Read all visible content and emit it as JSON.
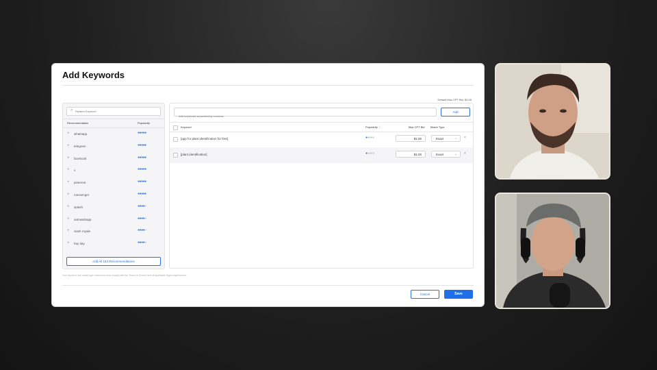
{
  "modal": {
    "title": "Add Keywords",
    "default_bid": "Default Max CPT Bid: $1.00",
    "footnote": "Your keyword and match type selections must comply with the Terms of Service and all applicable legal requirements.",
    "cancel_label": "Cancel",
    "save_label": "Save"
  },
  "recommendations": {
    "search_placeholder": "Related Keyword",
    "col_recommendation": "Recommendation",
    "col_popularity": "Popularity",
    "items": [
      {
        "label": "whatsapp",
        "popularity": 5
      },
      {
        "label": "telegram",
        "popularity": 5
      },
      {
        "label": "facebook",
        "popularity": 5
      },
      {
        "label": "x",
        "popularity": 5
      },
      {
        "label": "pinterest",
        "popularity": 5
      },
      {
        "label": "messenger",
        "popularity": 5
      },
      {
        "label": "splash",
        "popularity": 4
      },
      {
        "label": "autowatsapp",
        "popularity": 4
      },
      {
        "label": "clash royale",
        "popularity": 4
      },
      {
        "label": "hay day",
        "popularity": 4
      }
    ],
    "add_all_label": "Add All 163 Recommendations"
  },
  "keywords": {
    "input_placeholder": "Add keywords separated by commas",
    "add_label": "Add",
    "col_keyword": "Keyword",
    "col_popularity": "Popularity",
    "col_bid": "Max CPT Bid",
    "col_match": "Match Type",
    "rows": [
      {
        "keyword": "[app for plant identification for free]",
        "popularity": 1,
        "bid": "$1.00",
        "match": "Exact"
      },
      {
        "keyword": "[plant identification]",
        "popularity": 1,
        "bid": "$1.00",
        "match": "Exact"
      }
    ]
  },
  "video_tiles": [
    {
      "name": "participant-1"
    },
    {
      "name": "participant-2"
    }
  ],
  "colors": {
    "accent": "#1e6fe8",
    "dot_on": "#3a78d6",
    "dot_off": "#c7c7c7"
  }
}
